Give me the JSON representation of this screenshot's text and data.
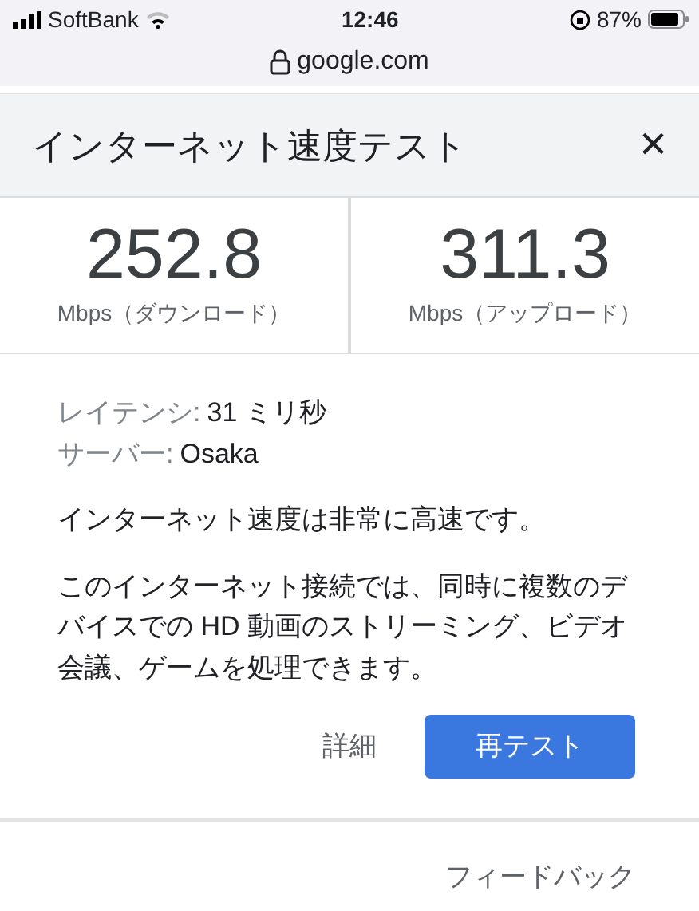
{
  "status_bar": {
    "carrier": "SoftBank",
    "time": "12:46",
    "battery": "87%"
  },
  "address_bar": {
    "url": "google.com"
  },
  "dialog": {
    "title": "インターネット速度テスト",
    "close": "×"
  },
  "results": [
    {
      "value": "252.8",
      "unit": "Mbps（ダウンロード）"
    },
    {
      "value": "311.3",
      "unit": "Mbps（アップロード）"
    }
  ],
  "details": [
    {
      "label": "レイテンシ:",
      "value": "31 ミリ秒"
    },
    {
      "label": "サーバー:",
      "value": "Osaka"
    }
  ],
  "summary": "インターネット速度は非常に高速です。",
  "description": "このインターネット接続では、同時に複数のデバイスでの HD 動画のストリーミング、ビデオ会議、ゲームを処理できます。",
  "buttons": [
    {
      "label": "詳細",
      "kind": "text"
    },
    {
      "label": "再テスト",
      "kind": "primary"
    }
  ],
  "feedback": "フィードバック"
}
